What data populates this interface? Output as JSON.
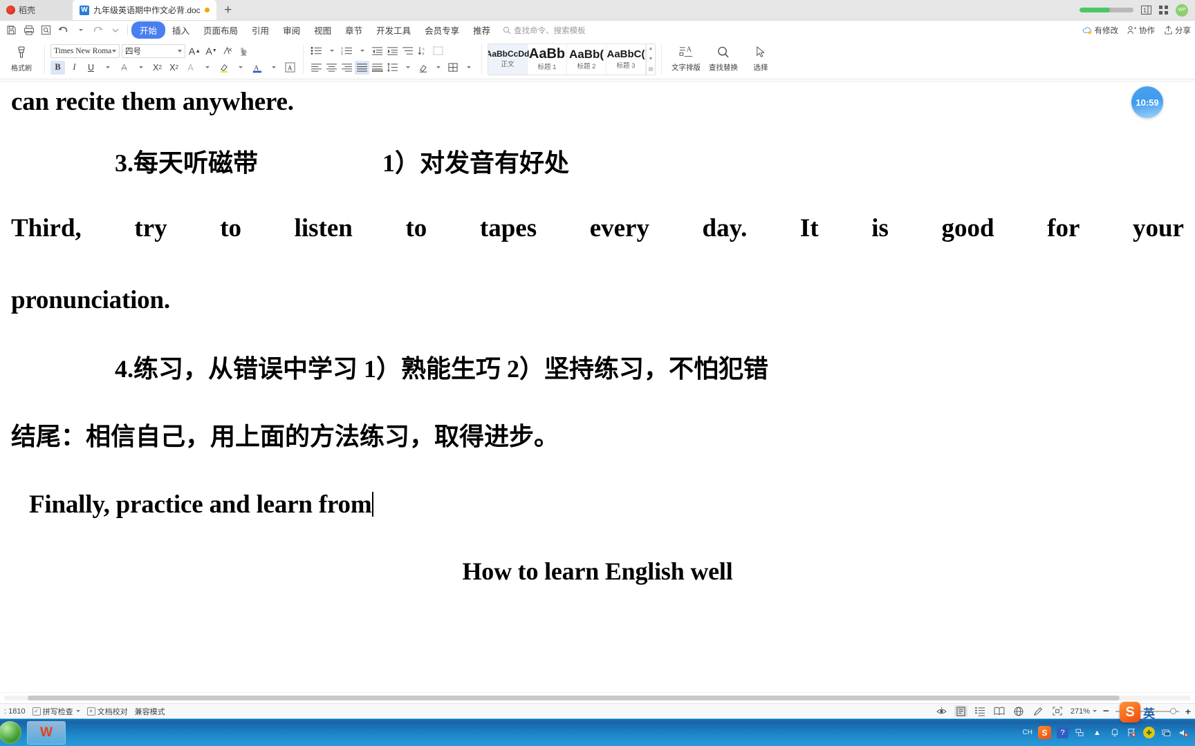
{
  "tabbar": {
    "home_tab": "稻壳",
    "doc_tab": "九年级英语期中作文必背.doc",
    "doc_icon": "wps-writer-icon",
    "new_tab": "+",
    "avatar_text": "WP",
    "icons": [
      "page-count-icon",
      "grid-apps-icon"
    ]
  },
  "menubar": {
    "quick_access": [
      "save-icon",
      "print-icon",
      "print-preview-icon",
      "undo-icon",
      "redo-icon",
      "customize-icon"
    ],
    "items": [
      {
        "label": "开始",
        "active": true
      },
      {
        "label": "插入",
        "active": false
      },
      {
        "label": "页面布局",
        "active": false
      },
      {
        "label": "引用",
        "active": false
      },
      {
        "label": "审阅",
        "active": false
      },
      {
        "label": "视图",
        "active": false
      },
      {
        "label": "章节",
        "active": false
      },
      {
        "label": "开发工具",
        "active": false
      },
      {
        "label": "会员专享",
        "active": false
      },
      {
        "label": "推荐",
        "active": false
      }
    ],
    "search_placeholder": "查找命令、搜索模板",
    "right_items": [
      {
        "label": "有修改",
        "icon": "cloud-sync-icon"
      },
      {
        "label": "协作",
        "icon": "collaborate-icon"
      },
      {
        "label": "分享",
        "icon": "share-icon"
      }
    ]
  },
  "ribbon": {
    "format_painter": "格式刷",
    "font_name": "Times New Roma",
    "font_size": "四号",
    "font_tools": [
      "grow-font-icon",
      "shrink-font-icon",
      "clear-format-icon",
      "pinyin-guide-icon"
    ],
    "font_row2": [
      "bold-icon",
      "italic-icon",
      "underline-icon",
      "strikethrough-icon",
      "superscript-icon",
      "subscript-icon",
      "text-effects-icon",
      "highlight-icon",
      "font-color-icon",
      "character-border-icon"
    ],
    "para_row1": [
      "bullets-icon",
      "numbering-icon",
      "decrease-indent-icon",
      "increase-indent-icon",
      "multilevel-list-icon",
      "sort-icon",
      "line-spacing-icon",
      "show-marks-icon"
    ],
    "para_row2": [
      "align-left-icon",
      "align-center-icon",
      "align-right-icon",
      "justify-icon",
      "distribute-icon",
      "line-space-icon",
      "shading-icon",
      "borders-icon"
    ],
    "styles": [
      {
        "preview": "AaBbCcDd",
        "name": "正文",
        "selected": true
      },
      {
        "preview": "AaBb",
        "name": "标题 1",
        "selected": false
      },
      {
        "preview": "AaBb(",
        "name": "标题 2",
        "selected": false
      },
      {
        "preview": "AaBbC(",
        "name": "标题 3",
        "selected": false
      }
    ],
    "buttons": [
      {
        "label": "文字排版",
        "icon": "text-layout-icon"
      },
      {
        "label": "查找替换",
        "icon": "search-icon"
      },
      {
        "label": "选择",
        "icon": "select-icon"
      }
    ]
  },
  "document": {
    "timer": "10:59",
    "lines": [
      {
        "type": "en",
        "text": "can recite them anywhere.",
        "indent": 0
      },
      {
        "type": "cn",
        "text": "3.每天听磁带　　　　　1）对发音有好处",
        "indent": 150
      },
      {
        "type": "justified",
        "words": [
          "Third,",
          "try",
          "to",
          "listen",
          "to",
          "tapes",
          "every",
          "day.",
          "It",
          "is",
          "good",
          "for",
          "your"
        ]
      },
      {
        "type": "en",
        "text": "pronunciation.",
        "indent": 0
      },
      {
        "type": "cn",
        "text": "4.练习，从错误中学习 1）熟能生巧 2）坚持练习，不怕犯错",
        "indent": 150
      },
      {
        "type": "cn",
        "text": "结尾：相信自己，用上面的方法练习，取得进步。",
        "indent": 0
      },
      {
        "type": "en-cursor",
        "text": "Finally, practice and learn from",
        "indent": 30
      },
      {
        "type": "en-center",
        "text": "How to learn English well",
        "indent": 0
      }
    ]
  },
  "status": {
    "word_count": ": 1810",
    "spell_check": "拼写检查",
    "doc_proof": "文档校对",
    "compat_mode": "兼容模式",
    "eye_icon": "eye-protection-icon",
    "views": [
      "page-view-icon",
      "outline-view-icon",
      "reading-view-icon",
      "web-view-icon",
      "edit-pen-icon"
    ],
    "fit_icon": "fit-page-icon",
    "zoom_level": "271%",
    "zoom_out": "−",
    "zoom_in": "+"
  },
  "taskbar": {
    "start": "start-orb-icon",
    "apps": [
      {
        "name": "wps-office-icon",
        "label": "W"
      }
    ],
    "tray": {
      "ime_label": "CH",
      "ime_mode": "英",
      "icons": [
        "sogou-pinyin-icon",
        "help-icon",
        "network-icon",
        "show-hidden-icon",
        "notification-icon",
        "flag-alert-icon",
        "update-icon",
        "display-icon",
        "volume-mute-icon"
      ]
    }
  },
  "colors": {
    "accent": "#4a7ff0",
    "tab_active_bg": "#ffffff",
    "taskbar": "#1c86c9",
    "progress": "#4cc764"
  }
}
